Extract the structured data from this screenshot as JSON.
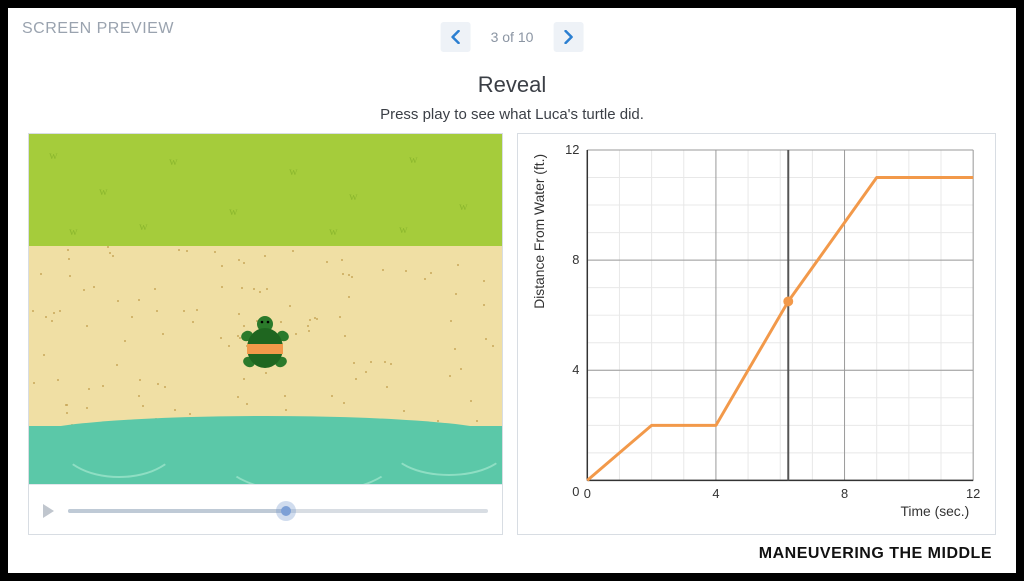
{
  "header": {
    "preview_label": "SCREEN PREVIEW",
    "page_indicator": "3 of 10"
  },
  "title": "Reveal",
  "subtitle": "Press play to see what Luca's turtle did.",
  "animation": {
    "playhead_fraction": 0.52
  },
  "chart_data": {
    "type": "line",
    "title": "",
    "xlabel": "Time (sec.)",
    "ylabel": "Distance From Water (ft.)",
    "xlim": [
      0,
      12
    ],
    "ylim": [
      0,
      12
    ],
    "xticks": [
      0,
      4,
      8,
      12
    ],
    "yticks": [
      4,
      8,
      12
    ],
    "series": [
      {
        "name": "turtle",
        "color": "#f2994a",
        "points": [
          {
            "x": 0,
            "y": 0
          },
          {
            "x": 2,
            "y": 2
          },
          {
            "x": 4,
            "y": 2
          },
          {
            "x": 6.25,
            "y": 6.5
          },
          {
            "x": 9,
            "y": 11
          },
          {
            "x": 12,
            "y": 11
          }
        ]
      }
    ],
    "marker": {
      "x": 6.25,
      "y": 6.5
    },
    "playhead_x": 6.25
  },
  "footer": {
    "brand": "MANEUVERING THE MIDDLE"
  }
}
